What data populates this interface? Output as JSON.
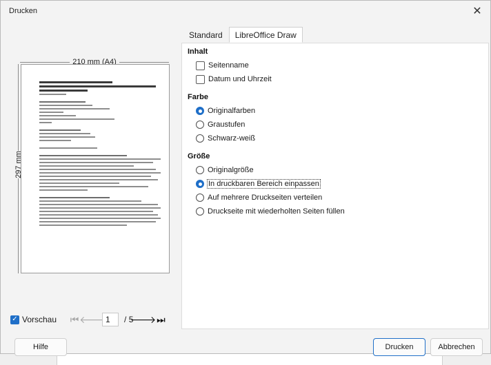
{
  "window": {
    "title": "Drucken",
    "close_label": "✕"
  },
  "preview": {
    "width_label": "210 mm (A4)",
    "height_label": "297 mm",
    "show_preview_label": "Vorschau",
    "show_preview_checked": true,
    "current_page": "1",
    "total_pages": "/ 5"
  },
  "tabs": [
    {
      "label": "Standard",
      "active": false
    },
    {
      "label": "LibreOffice Draw",
      "active": true
    }
  ],
  "sections": {
    "inhalt": {
      "title": "Inhalt",
      "options": [
        {
          "label": "Seitenname",
          "checked": false
        },
        {
          "label": "Datum und Uhrzeit",
          "checked": false
        }
      ]
    },
    "farbe": {
      "title": "Farbe",
      "options": [
        {
          "label": "Originalfarben",
          "selected": true
        },
        {
          "label": "Graustufen",
          "selected": false
        },
        {
          "label": "Schwarz-weiß",
          "selected": false
        }
      ]
    },
    "groesse": {
      "title": "Größe",
      "options": [
        {
          "label": "Originalgröße",
          "selected": false
        },
        {
          "label": "In druckbaren Bereich einpassen",
          "selected": true
        },
        {
          "label": "Auf mehrere Druckseiten verteilen",
          "selected": false
        },
        {
          "label": "Druckseite mit wiederholten Seiten füllen",
          "selected": false
        }
      ]
    }
  },
  "buttons": {
    "help": "Hilfe",
    "print": "Drucken",
    "cancel": "Abbrechen"
  },
  "colors": {
    "accent": "#1f6fc8",
    "dialog_bg": "#f3f3f3"
  }
}
